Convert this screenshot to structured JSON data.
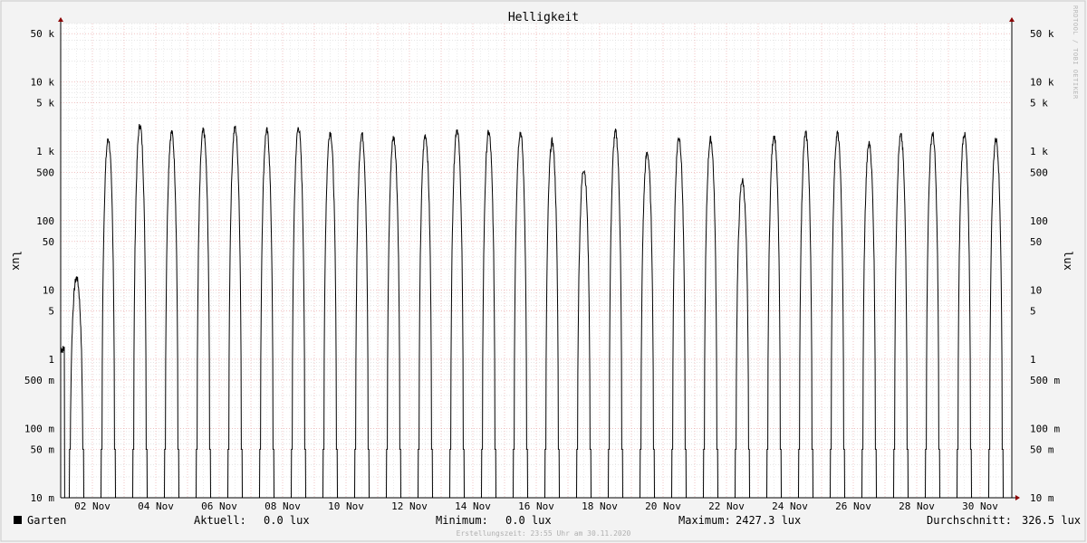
{
  "chart_data": {
    "type": "line",
    "title": "Helligkeit",
    "ylabel": "lux",
    "yscale": "log",
    "ylim": [
      0.01,
      70000
    ],
    "ytick_values": [
      0.01,
      0.05,
      0.1,
      0.5,
      1,
      5,
      10,
      50,
      100,
      500,
      1000,
      5000,
      10000,
      50000
    ],
    "ytick_labels": [
      "10 m",
      "50 m",
      "100 m",
      "500 m",
      "1",
      "5",
      "10",
      "50",
      "100",
      "500",
      "1 k",
      "5 k",
      "10 k",
      "50 k"
    ],
    "x_start_day": 1.0,
    "x_end_day": 31.0,
    "xtick_days": [
      2,
      4,
      6,
      8,
      10,
      12,
      14,
      16,
      18,
      20,
      22,
      24,
      26,
      28,
      30
    ],
    "xtick_labels": [
      "02 Nov",
      "04 Nov",
      "06 Nov",
      "08 Nov",
      "10 Nov",
      "12 Nov",
      "14 Nov",
      "16 Nov",
      "18 Nov",
      "20 Nov",
      "22 Nov",
      "24 Nov",
      "26 Nov",
      "28 Nov",
      "30 Nov"
    ],
    "grid": true,
    "series": [
      {
        "name": "Garten",
        "color": "#000000",
        "daily_peak_lux": [
          15,
          1500,
          2400,
          1900,
          2000,
          2200,
          2000,
          2200,
          1900,
          1800,
          1600,
          1700,
          2100,
          1900,
          1900,
          1400,
          560,
          1900,
          950,
          1600,
          1500,
          380,
          1700,
          1800,
          1800,
          1300,
          1700,
          1800,
          1800,
          1500
        ]
      }
    ]
  },
  "legend": {
    "series_label": "Garten",
    "current_label": "Aktuell:",
    "current_value": "0.0 lux",
    "min_label": "Minimum:",
    "min_value": "0.0 lux",
    "max_label": "Maximum:",
    "max_value": "2427.3 lux",
    "avg_label": "Durchschnitt:",
    "avg_value": "326.5 lux"
  },
  "footer_text": "Erstellungszeit: 23:55 Uhr am 30.11.2020",
  "watermark": "RRDTOOL / TOBI OETIKER"
}
